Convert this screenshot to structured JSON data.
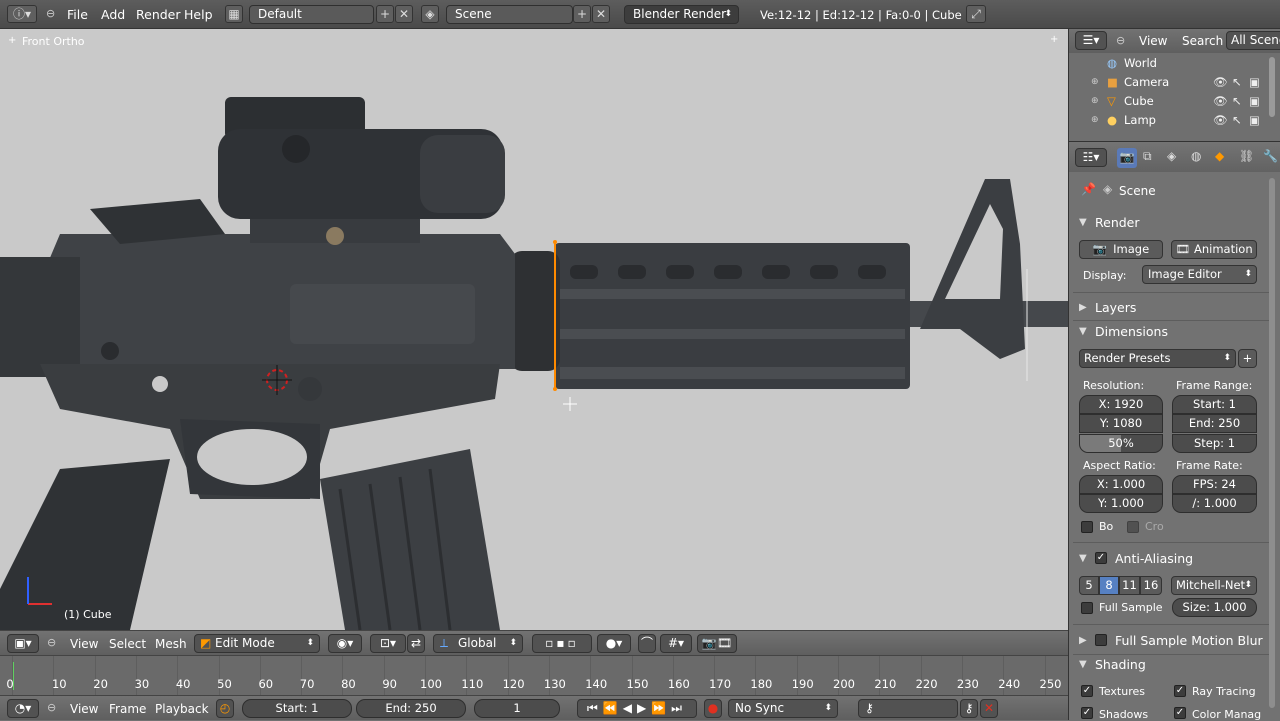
{
  "top": {
    "menus": [
      "File",
      "Add",
      "Render",
      "Help"
    ],
    "layout": "Default",
    "scene": "Scene",
    "engine": "Blender Render",
    "stats": "Ve:12-12 | Ed:12-12 | Fa:0-0 | Cube"
  },
  "viewport": {
    "view_label": "Front Ortho",
    "object_label": "(1) Cube"
  },
  "v3d_header": {
    "menus": [
      "View",
      "Select",
      "Mesh"
    ],
    "mode": "Edit Mode",
    "orientation": "Global"
  },
  "timeline": {
    "ticks": [
      "0",
      "10",
      "20",
      "30",
      "40",
      "50",
      "60",
      "70",
      "80",
      "90",
      "100",
      "110",
      "120",
      "130",
      "140",
      "150",
      "160",
      "170",
      "180",
      "190",
      "200",
      "210",
      "220",
      "230",
      "240",
      "250"
    ],
    "menus": [
      "View",
      "Frame",
      "Playback"
    ],
    "start": "Start: 1",
    "end": "End: 250",
    "current": "1",
    "sync": "No Sync"
  },
  "outliner": {
    "menus": [
      "View",
      "Search"
    ],
    "filter": "All Scenes",
    "items": [
      "World",
      "Camera",
      "Cube",
      "Lamp"
    ]
  },
  "props": {
    "scene": "Scene",
    "render_title": "Render",
    "image_btn": "Image",
    "anim_btn": "Animation",
    "display_label": "Display:",
    "display_value": "Image Editor",
    "layers": "Layers",
    "dimensions": "Dimensions",
    "presets": "Render Presets",
    "resolution_label": "Resolution:",
    "res_x": "X: 1920",
    "res_y": "Y: 1080",
    "res_pct": "50%",
    "frame_range_label": "Frame Range:",
    "start": "Start: 1",
    "end": "End: 250",
    "step": "Step: 1",
    "aspect_label": "Aspect Ratio:",
    "asp_x": "X: 1.000",
    "asp_y": "Y: 1.000",
    "frame_rate_label": "Frame Rate:",
    "fps": "FPS: 24",
    "fps_base": "/: 1.000",
    "border": "Bo",
    "crop": "Cro",
    "aa": "Anti-Aliasing",
    "aa_samples": [
      "5",
      "8",
      "11",
      "16"
    ],
    "aa_filter": "Mitchell-Net",
    "full_sample": "Full Sample",
    "size": "Size: 1.000",
    "fsmb": "Full Sample Motion Blur",
    "shading": "Shading",
    "textures": "Textures",
    "raytracing": "Ray Tracing",
    "shadows": "Shadows",
    "colormgmt": "Color Manag"
  }
}
